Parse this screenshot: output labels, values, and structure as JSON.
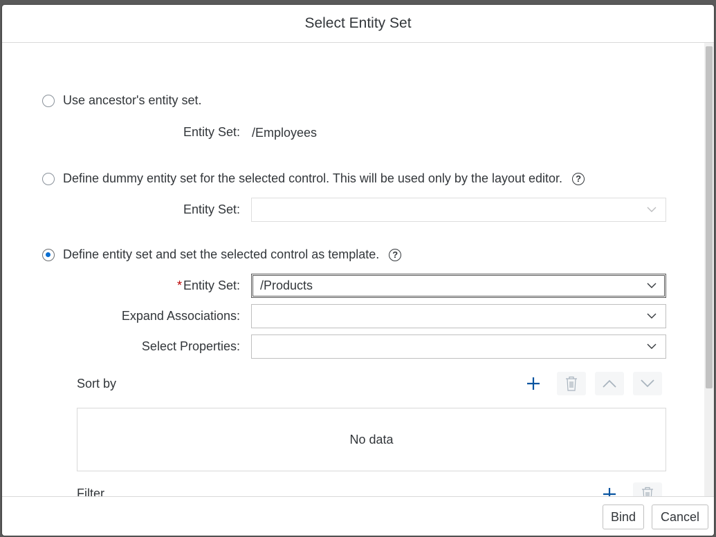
{
  "dialog": {
    "title": "Select Entity Set",
    "options": [
      {
        "label": "Use ancestor's entity set.",
        "checked": false,
        "help": false
      },
      {
        "label": "Define dummy entity set for the selected control. This will be used only by the layout editor.",
        "checked": false,
        "help": true
      },
      {
        "label": "Define entity set and set the selected control as template.",
        "checked": true,
        "help": true
      }
    ],
    "ancestor": {
      "entity_set_label": "Entity Set:",
      "entity_set_value": "/Employees"
    },
    "dummy": {
      "entity_set_label": "Entity Set:",
      "entity_set_value": ""
    },
    "template": {
      "required_marker": "*",
      "entity_set_label": "Entity Set:",
      "entity_set_value": "/Products",
      "expand_label": "Expand Associations:",
      "expand_value": "",
      "select_label": "Select Properties:",
      "select_value": ""
    },
    "sort": {
      "title": "Sort by",
      "empty_text": "No data"
    },
    "filter": {
      "title": "Filter"
    },
    "help_glyph": "?",
    "buttons": {
      "bind": "Bind",
      "cancel": "Cancel"
    }
  },
  "colors": {
    "accent": "#0a6ed1",
    "required": "#bb0000",
    "text": "#32363a",
    "icon_active": "#0854a0",
    "icon_disabled": "#a9b4be"
  },
  "icons": {
    "add": "plus-icon",
    "delete": "trash-icon",
    "up": "chevron-up-icon",
    "down": "chevron-down-icon",
    "help": "help-icon"
  }
}
